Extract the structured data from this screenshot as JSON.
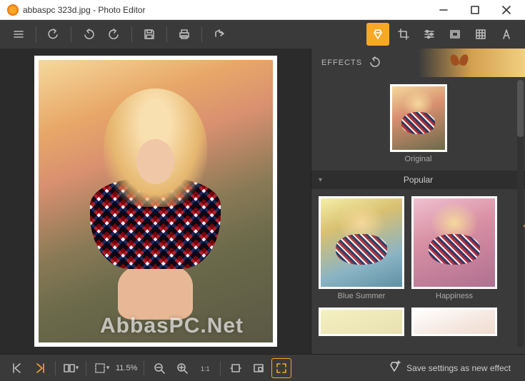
{
  "window": {
    "title": "abbaspc 323d.jpg - Photo Editor"
  },
  "tools": {
    "effects_tab": "Effects",
    "crop_tab": "Crop",
    "adjust_tab": "Adjust",
    "frame_tab": "Frame",
    "texture_tab": "Texture",
    "text_tab": "Text"
  },
  "effects": {
    "header": "EFFECTS",
    "original_label": "Original",
    "category": "Popular",
    "items": [
      {
        "label": "Blue Summer"
      },
      {
        "label": "Happiness"
      }
    ],
    "save_button": "Save settings as new effect"
  },
  "zoom": {
    "level": "11.5%"
  },
  "watermark": "AbbasPC.Net"
}
